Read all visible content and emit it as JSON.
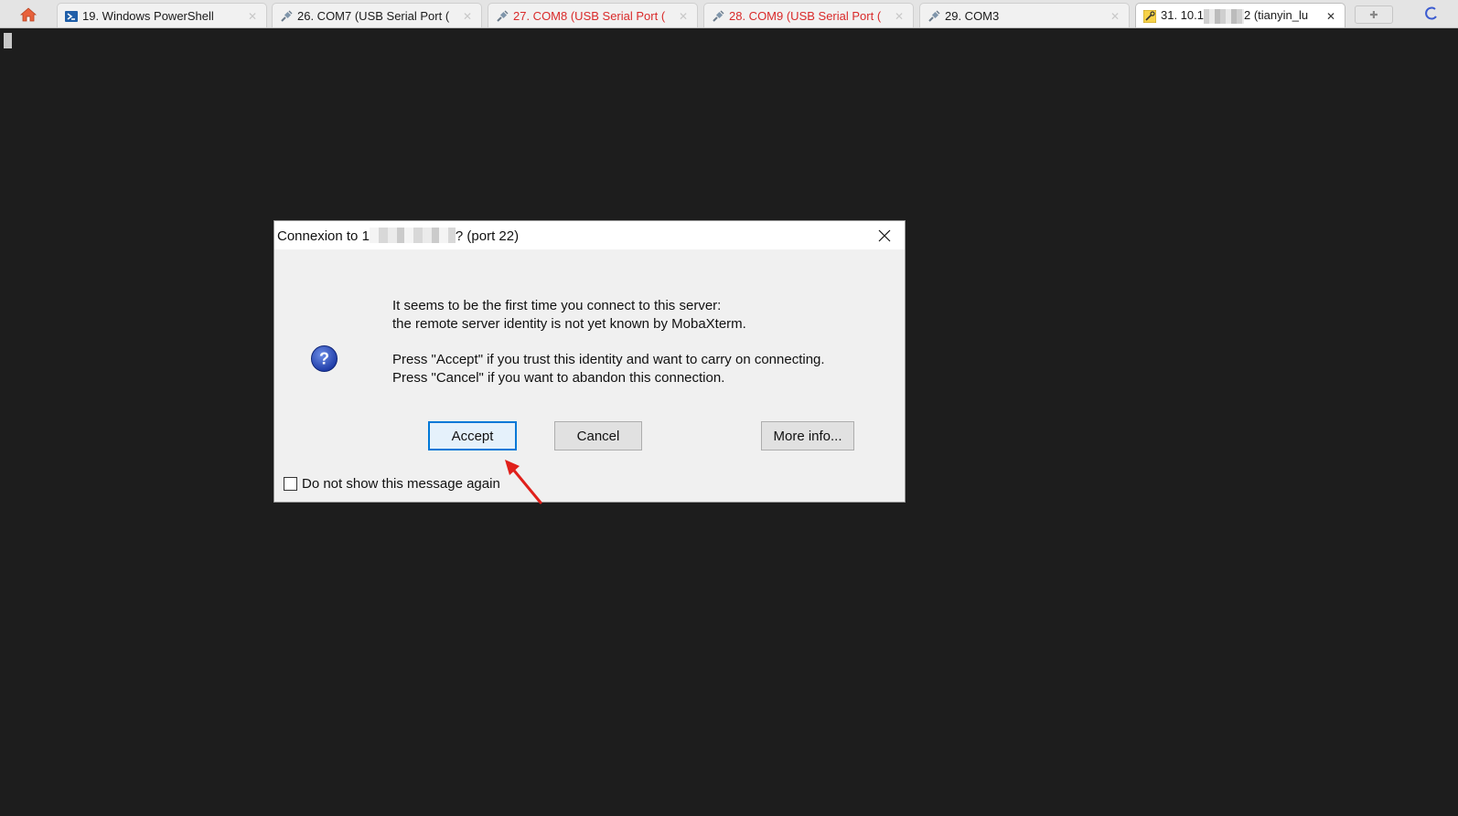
{
  "tabs": [
    {
      "label": "19. Windows PowerShell",
      "icon": "powershell-icon",
      "state": "normal"
    },
    {
      "label": "26. COM7  (USB Serial Port (",
      "icon": "serial-plug-icon",
      "state": "normal"
    },
    {
      "label": "27. COM8  (USB Serial Port (",
      "icon": "serial-plug-icon",
      "state": "disconnected"
    },
    {
      "label": "28. COM9  (USB Serial Port (",
      "icon": "serial-plug-icon",
      "state": "disconnected"
    },
    {
      "label": "29. COM3",
      "icon": "serial-plug-icon",
      "state": "normal"
    },
    {
      "label_prefix": "31. 10.1",
      "label_suffix": "2 (tianyin_lu",
      "icon": "ssh-key-icon",
      "state": "active"
    }
  ],
  "dialog": {
    "title_prefix": "Connexion to 1",
    "title_suffix": "? (port 22)",
    "message_line1": "It seems to be the first time you connect to this server:",
    "message_line2": "the remote server identity is not yet known by MobaXterm.",
    "message_line3": "Press \"Accept\" if you trust this identity and want to carry on connecting.",
    "message_line4": "Press \"Cancel\" if you want to abandon this connection.",
    "accept_label": "Accept",
    "cancel_label": "Cancel",
    "more_info_label": "More info...",
    "checkbox_label": "Do not show this message again",
    "checkbox_checked": false
  },
  "colors": {
    "terminal_bg": "#1d1d1d",
    "dialog_bg": "#f0f0f0",
    "default_button_border": "#0078d7",
    "disconnected_tab_text": "#d92a2a",
    "annotation_arrow": "#e0201b"
  }
}
